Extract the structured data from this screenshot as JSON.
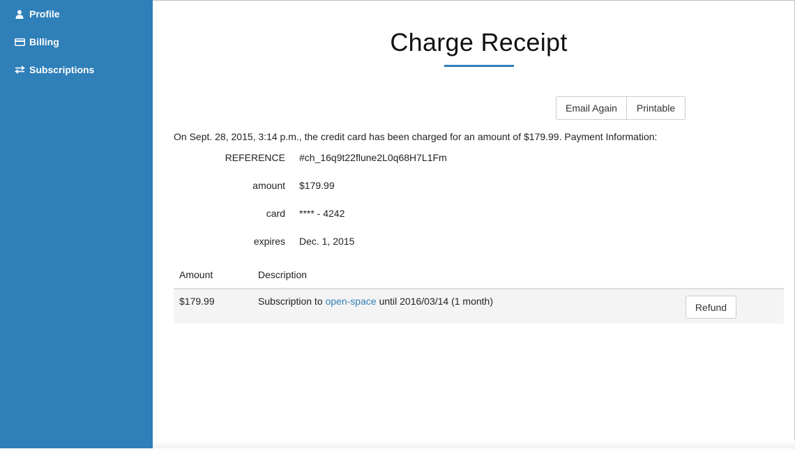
{
  "sidebar": {
    "items": [
      {
        "label": "Profile",
        "icon": "user-icon"
      },
      {
        "label": "Billing",
        "icon": "credit-card-icon"
      },
      {
        "label": "Subscriptions",
        "icon": "exchange-icon"
      }
    ]
  },
  "page": {
    "title": "Charge Receipt"
  },
  "actions": {
    "email_again_label": "Email Again",
    "printable_label": "Printable"
  },
  "summary": {
    "text": "On Sept. 28, 2015, 3:14 p.m., the credit card has been charged for an amount of $179.99. Payment Information:"
  },
  "payment_info": [
    {
      "label": "REFERENCE",
      "value": "#ch_16q9t22flune2L0q68H7L1Fm"
    },
    {
      "label": "amount",
      "value": "$179.99"
    },
    {
      "label": "card",
      "value": "**** - 4242"
    },
    {
      "label": "expires",
      "value": "Dec. 1, 2015"
    }
  ],
  "table": {
    "headers": {
      "amount": "Amount",
      "description": "Description"
    },
    "rows": [
      {
        "amount": "$179.99",
        "description_prefix": "Subscription to",
        "description_link": "open-space",
        "description_suffix": "until 2016/03/14 (1 month)",
        "action_label": "Refund"
      }
    ]
  },
  "colors": {
    "brand": "#2f7fb8",
    "row_background": "#f4f4f4"
  }
}
